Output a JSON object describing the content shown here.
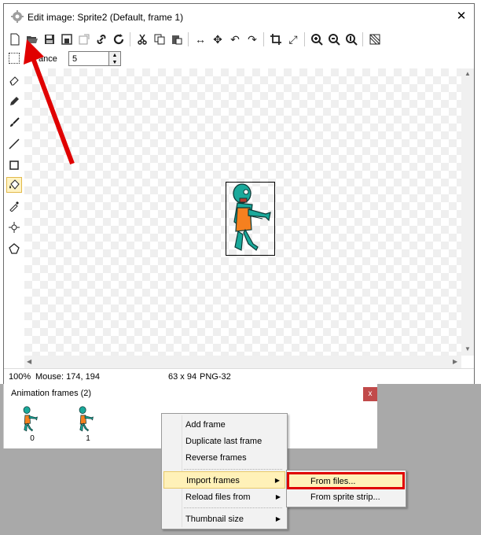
{
  "window": {
    "title": "Edit image: Sprite2 (Default, frame 1)",
    "close_glyph": "✕"
  },
  "toolbar": {
    "icons": [
      "new-icon",
      "open-folder-icon",
      "save-icon",
      "save-as-icon",
      "export-icon",
      "link-icon",
      "refresh-icon",
      "cut-icon",
      "copy-icon",
      "paste-icon",
      "move-horizontal-icon",
      "move-vertical-icon",
      "undo-icon",
      "redo-icon",
      "crop-icon",
      "resize-icon",
      "zoom-in-icon",
      "zoom-out-icon",
      "zoom-reset-icon",
      "grid-icon"
    ]
  },
  "options": {
    "tolerance_label": "ance",
    "tolerance_value": "5"
  },
  "tools": [
    "select-icon",
    "eraser-icon",
    "pencil-icon",
    "brush-icon",
    "line-icon",
    "rectangle-icon",
    "fill-icon",
    "eyedropper-icon",
    "origin-icon",
    "polygon-icon"
  ],
  "status": {
    "zoom": "100%",
    "mouse": "Mouse: 174, 194",
    "size": "63 x 94",
    "format": "PNG-32"
  },
  "animation_panel": {
    "title": "Animation frames (2)",
    "close_glyph": "x",
    "frames": [
      {
        "label": "0"
      },
      {
        "label": "1"
      }
    ]
  },
  "context_menu": {
    "items": [
      {
        "label": "Add frame"
      },
      {
        "label": "Duplicate last frame"
      },
      {
        "label": "Reverse frames"
      },
      {
        "label": "Import frames"
      },
      {
        "label": "Reload files from"
      },
      {
        "label": "Thumbnail size"
      }
    ],
    "submenu_glyph": "▶"
  },
  "submenu": {
    "items": [
      {
        "label": "From files..."
      },
      {
        "label": "From sprite strip..."
      }
    ]
  },
  "colors": {
    "annotation_red": "#e00000",
    "highlight": "#fff1b8",
    "zombie_skin": "#1aa99b",
    "zombie_outfit": "#f5801f"
  }
}
